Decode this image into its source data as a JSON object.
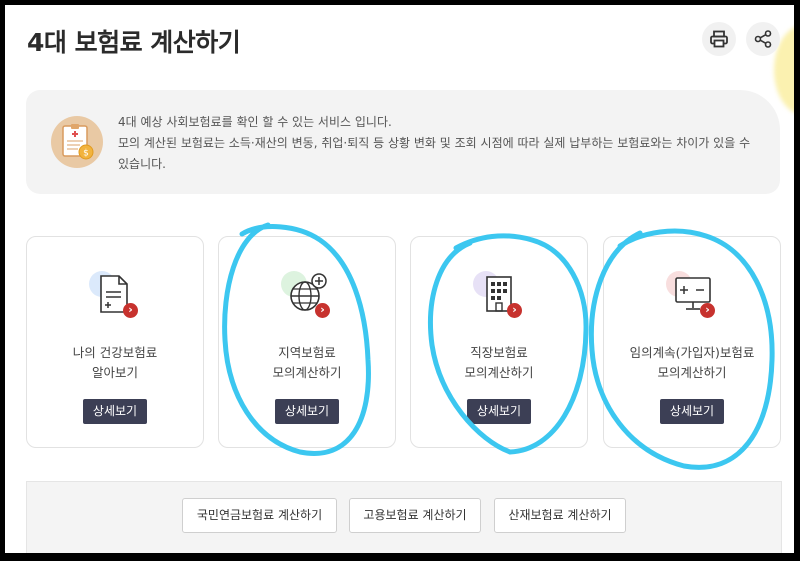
{
  "page": {
    "title": "4대 보험료 계산하기"
  },
  "toolbar": {
    "print_icon": "print-icon",
    "share_icon": "share-icon"
  },
  "info": {
    "icon": "document-coin-icon",
    "line1": "4대 예상 사회보험료를 확인 할 수 있는 서비스 입니다.",
    "line2": "모의 계산된 보험료는 소득·재산의 변동, 취업·퇴직 등 상황 변화 및 조회 시점에 따라 실제 납부하는 보험료와는 차이가 있을 수",
    "line3": "있습니다."
  },
  "cards": [
    {
      "icon": "document-plus-icon",
      "blob_color": "#dbe9fb",
      "label_line1": "나의 건강보험료",
      "label_line2": "알아보기",
      "button": "상세보기"
    },
    {
      "icon": "globe-plus-icon",
      "blob_color": "#ddf3df",
      "label_line1": "지역보험료",
      "label_line2": "모의계산하기",
      "button": "상세보기"
    },
    {
      "icon": "building-icon",
      "blob_color": "#e7e1f6",
      "label_line1": "직장보험료",
      "label_line2": "모의계산하기",
      "button": "상세보기"
    },
    {
      "icon": "monitor-calc-icon",
      "blob_color": "#f8dede",
      "label_line1": "임의계속(가입자)보험료",
      "label_line2": "모의계산하기",
      "button": "상세보기"
    }
  ],
  "bottom": {
    "buttons": [
      "국민연금보험료 계산하기",
      "고용보험료 계산하기",
      "산재보험료 계산하기"
    ]
  },
  "colors": {
    "accent_button": "#3c3f55",
    "badge": "#c7322e",
    "annotation": "#3cc7f0"
  }
}
